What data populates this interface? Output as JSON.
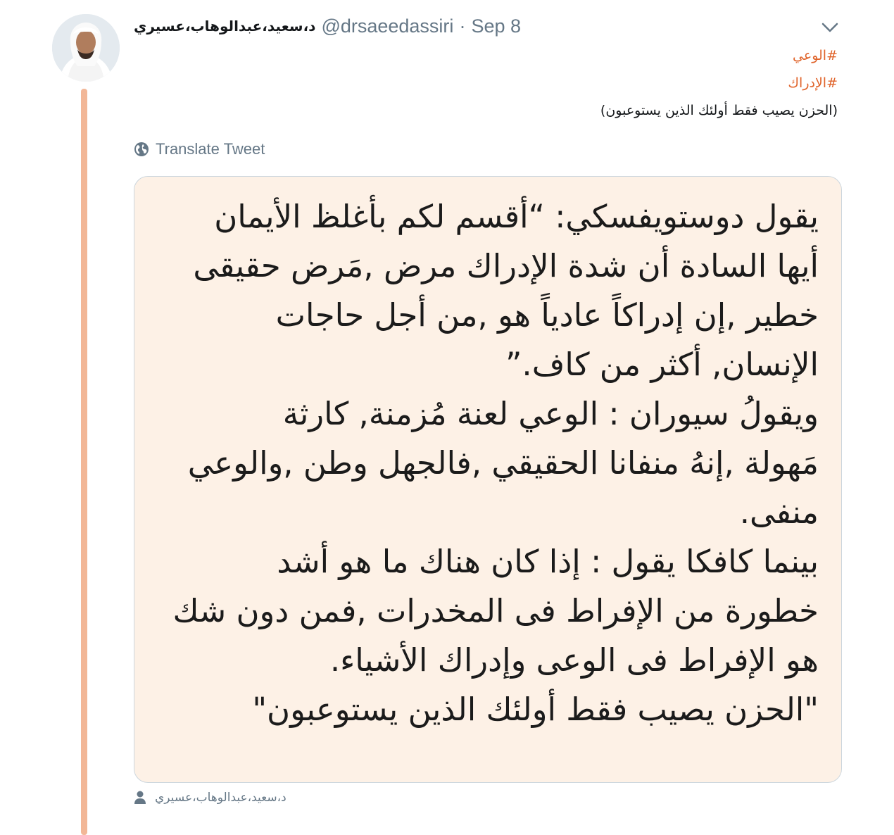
{
  "tweet": {
    "author": {
      "display_name": "د،سعيد،عبدالوهاب،عسيري",
      "handle": "@drsaeedassiri",
      "avatar_icon": "profile-photo"
    },
    "date": "Sep 8",
    "separator": "·",
    "more_icon": "chevron-down-icon",
    "text_lines": [
      {
        "hashtag": "#الوعي"
      },
      {
        "hashtag": "#الإدراك"
      },
      {
        "text": "(الحزن يصيب فقط أولئك الذين يستوعبون)"
      }
    ],
    "translate_label": "Translate Tweet",
    "translate_icon": "globe-icon",
    "media": {
      "lines": [
        "يقول دوستويفسكي: “أقسم لكم بأغلظ الأيمان",
        "أيها السادة أن شدة الإدراك مرض ,مَرض حقيقى",
        "خطير ,إن إدراكاً عادياً هو ,من أجل حاجات",
        "الإنسان, أكثر من كاف.”",
        "ويقولُ سيوران : الوعي لعنة مُزمنة, كارثة",
        "مَهولة ,إنهُ منفانا الحقيقي ,فالجهل وطن ,والوعي",
        "منفى.",
        "بينما كافكا يقول : إذا كان هناك ما هو أشد",
        "خطورة من الإفراط فى المخدرات ,فمن دون شك",
        "هو الإفراط فى الوعى وإدراك الأشياء.",
        "\"الحزن يصيب فقط أولئك الذين يستوعبون\""
      ]
    },
    "tagged_user": {
      "name": "د،سعيد،عبدالوهاب،عسيري",
      "icon": "person-icon"
    }
  },
  "colors": {
    "hashtag": "#e0642b",
    "thread_line": "#f2b797",
    "media_background": "#fdf1e6",
    "secondary_text": "#657786"
  }
}
